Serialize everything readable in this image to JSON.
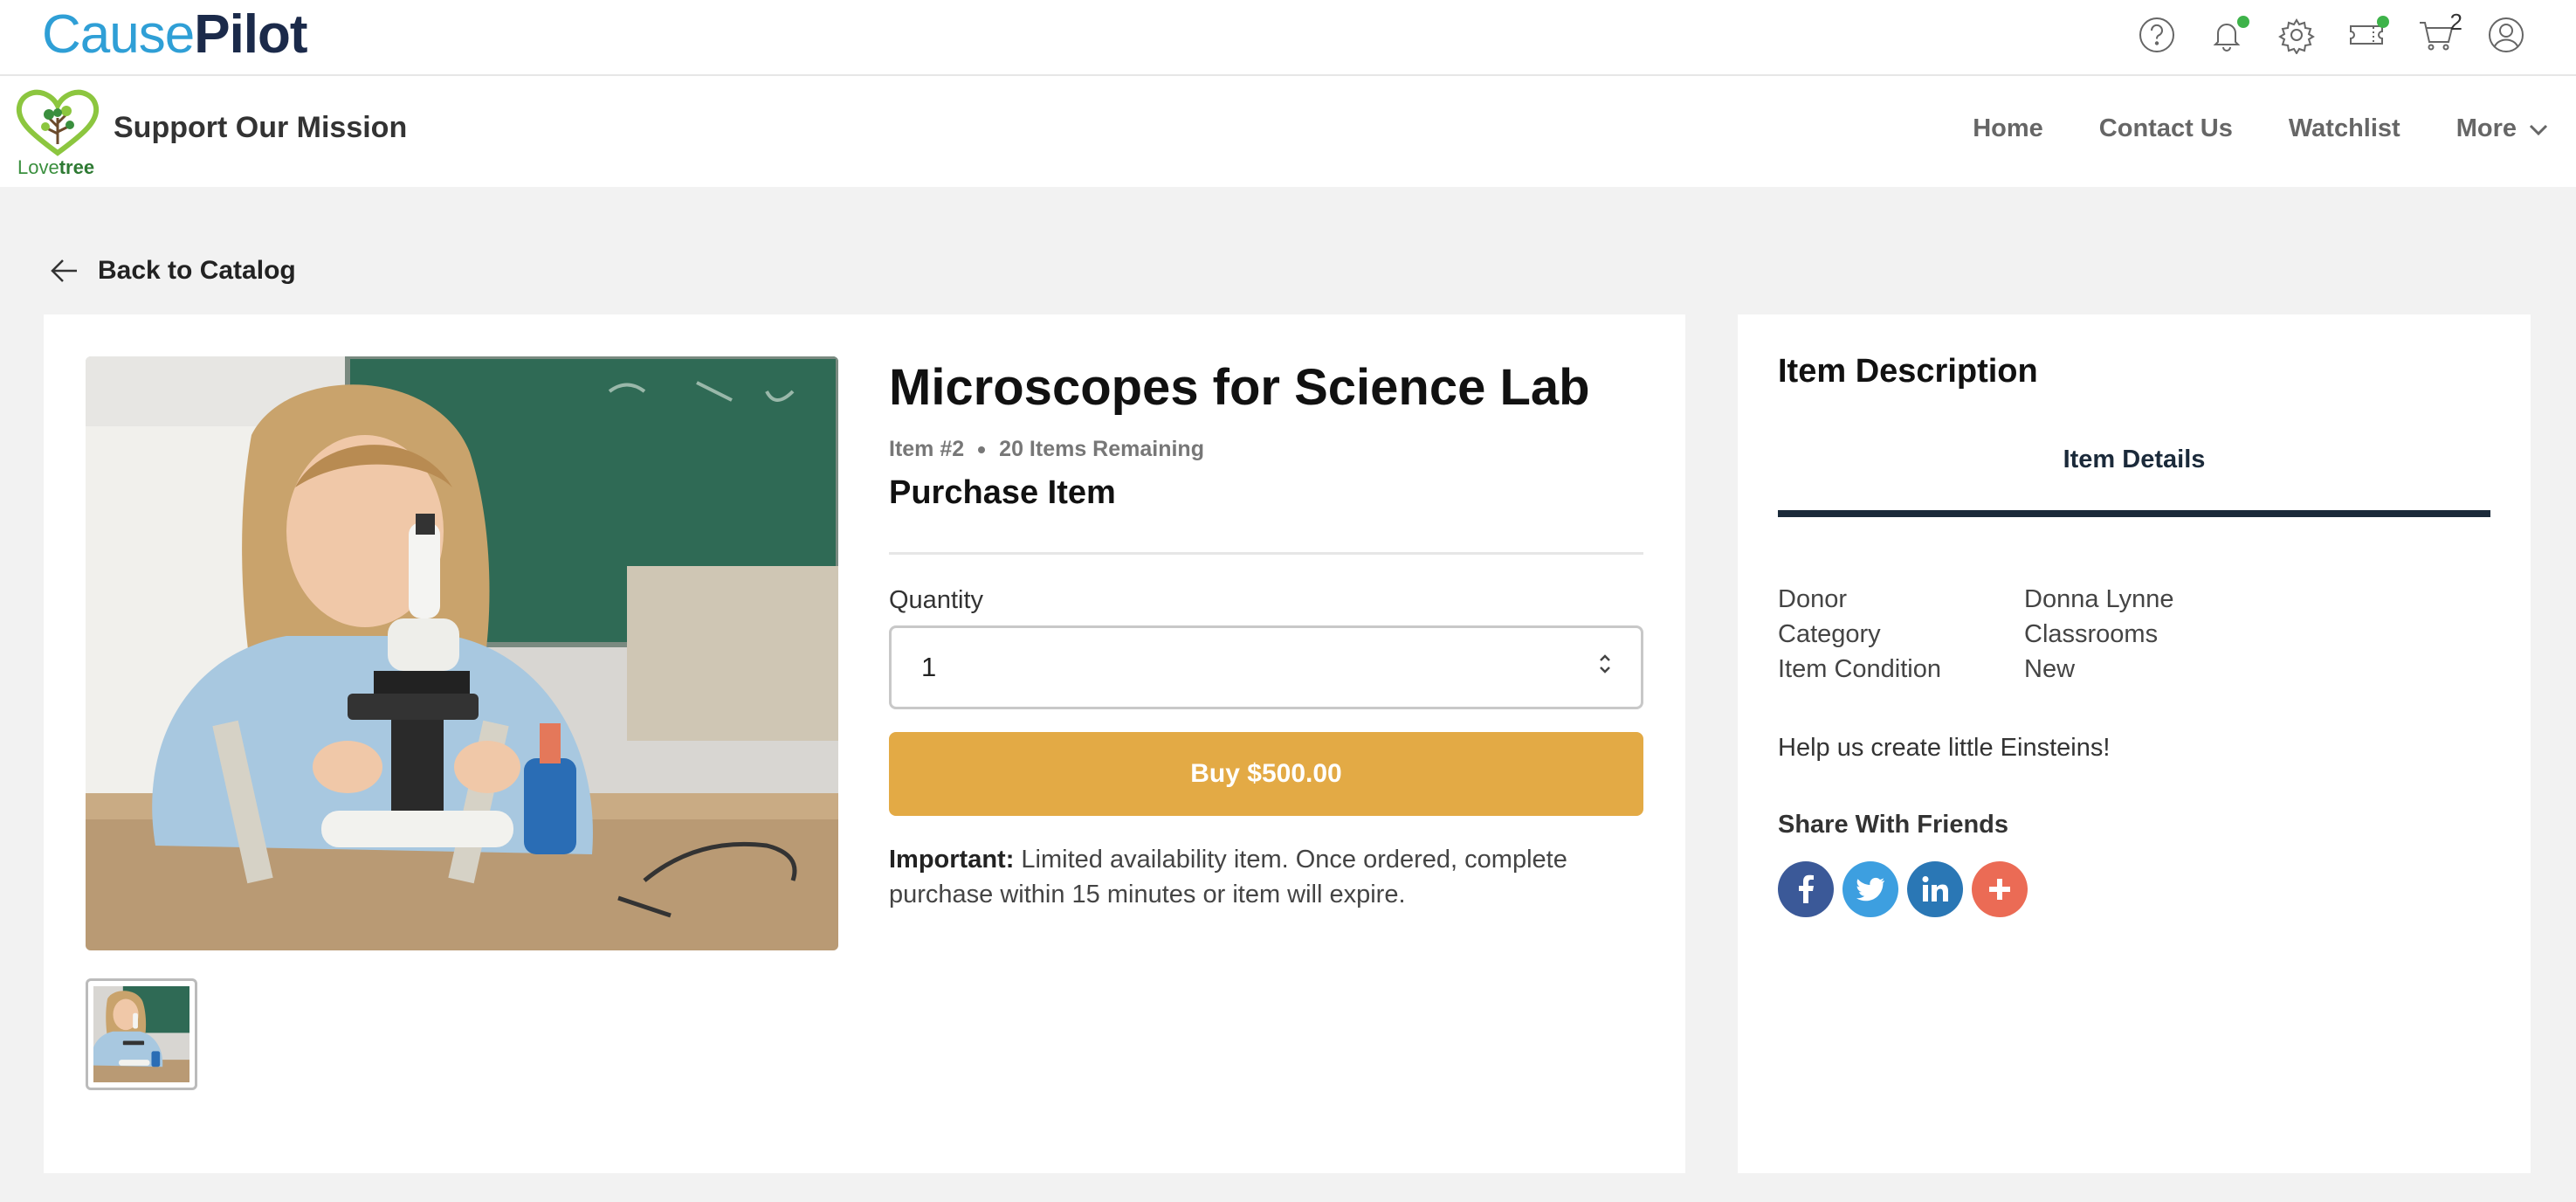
{
  "brand": {
    "cause": "Cause",
    "pilot": "Pilot"
  },
  "top_icons": [
    {
      "icon": "help-icon"
    },
    {
      "icon": "bell-icon",
      "badge": true
    },
    {
      "icon": "gear-icon"
    },
    {
      "icon": "ticket-icon",
      "badge": true
    },
    {
      "icon": "cart-icon",
      "count": "2"
    },
    {
      "icon": "user-icon"
    }
  ],
  "org": {
    "logo_text_love": "Love",
    "logo_text_tree": "tree",
    "name": "Support Our Mission"
  },
  "nav": {
    "home": "Home",
    "contact": "Contact Us",
    "watchlist": "Watchlist",
    "more": "More"
  },
  "back_label": "Back to Catalog",
  "item": {
    "title": "Microscopes for Science Lab",
    "number": "Item #2",
    "remaining": "20 Items Remaining",
    "purchase_heading": "Purchase Item",
    "quantity_label": "Quantity",
    "quantity_value": "1",
    "buy_label": "Buy $500.00",
    "important_label": "Important:",
    "important_text": " Limited availability item. Once ordered, complete purchase within 15 minutes or item will expire."
  },
  "description": {
    "title": "Item Description",
    "tab_label": "Item Details",
    "rows": [
      {
        "key": "Donor",
        "value": "Donna Lynne"
      },
      {
        "key": "Category",
        "value": "Classrooms"
      },
      {
        "key": "Item Condition",
        "value": "New"
      }
    ],
    "text": "Help us create little Einsteins!",
    "share_label": "Share With Friends",
    "social": [
      "facebook-icon",
      "twitter-icon",
      "linkedin-icon",
      "plus-icon"
    ]
  },
  "colors": {
    "accent": "#e3aa45",
    "brand_blue": "#2f9fd6",
    "brand_navy": "#1b2a4a",
    "badge_green": "#3eb34a",
    "facebook": "#3b5998",
    "twitter": "#3d9fe0",
    "linkedin": "#2a77b5",
    "plus": "#eb6b55"
  }
}
